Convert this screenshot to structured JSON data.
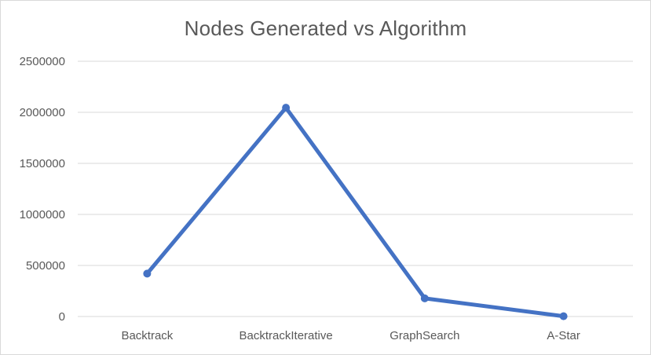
{
  "chart_data": {
    "type": "line",
    "title": "Nodes Generated vs Algorithm",
    "xlabel": "",
    "ylabel": "",
    "categories": [
      "Backtrack",
      "BacktrackIterative",
      "GraphSearch",
      "A-Star"
    ],
    "series": [
      {
        "values": [
          420000,
          2045000,
          178000,
          3000
        ],
        "color": "#4472c4"
      }
    ],
    "ylim": [
      0,
      2500000
    ],
    "yticks": [
      0,
      500000,
      1000000,
      1500000,
      2000000,
      2500000
    ],
    "ytick_labels": [
      "0",
      "500000",
      "1000000",
      "1500000",
      "2000000",
      "2500000"
    ],
    "grid": true,
    "legend": "none",
    "colors": {
      "grid": "#d9d9d9",
      "text": "#595959",
      "line": "#4472c4"
    }
  }
}
